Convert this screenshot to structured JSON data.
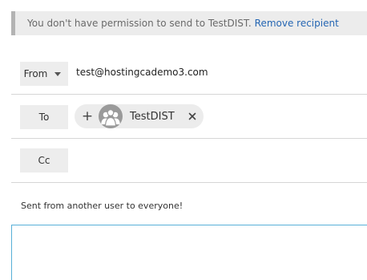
{
  "banner": {
    "message": "You don't have permission to send to TestDIST.",
    "link_label": "Remove recipient"
  },
  "from": {
    "button_label": "From",
    "address": "test@hostingcademo3.com",
    "caret_icon": "chevron-down-icon"
  },
  "to": {
    "button_label": "To",
    "recipients": [
      {
        "name": "TestDIST",
        "avatar_icon": "group-icon"
      }
    ],
    "add_icon": "plus-icon",
    "remove_icon": "close-icon"
  },
  "cc": {
    "button_label": "Cc"
  },
  "message": {
    "body": "Sent from another user to everyone!"
  },
  "colors": {
    "link": "#2566b3",
    "editor_border": "#58b0d8",
    "banner_bg": "#ececec"
  }
}
